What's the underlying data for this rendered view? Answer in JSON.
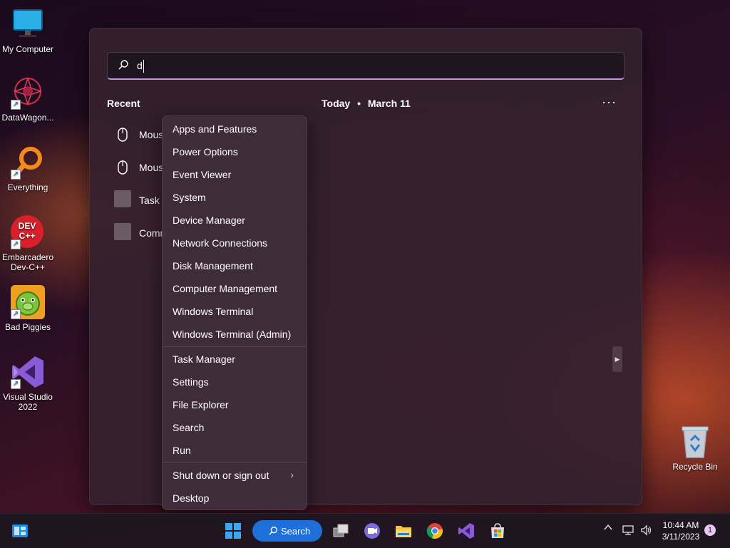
{
  "desktop": {
    "icons": [
      {
        "label": "My Computer"
      },
      {
        "label": "DataWagon..."
      },
      {
        "label": "Everything"
      },
      {
        "label": "Embarcadero Dev-C++",
        "badge_text": "DEV C++"
      },
      {
        "label": "Bad Piggies"
      },
      {
        "label": "Visual Studio 2022"
      },
      {
        "label": "Recycle Bin"
      }
    ]
  },
  "start": {
    "search": {
      "value": "d",
      "icon": "search-icon"
    },
    "recent_title": "Recent",
    "recent_items": [
      {
        "label": "Mous",
        "icon": "mouse-icon"
      },
      {
        "label": "Mous",
        "icon": "mouse-icon"
      },
      {
        "label": "Task I",
        "icon": "app-icon"
      },
      {
        "label": "Comm",
        "icon": "app-icon"
      }
    ],
    "today": "Today",
    "bullet": "•",
    "date": "March 11",
    "more": "···"
  },
  "context_menu": {
    "group1": [
      "Apps and Features",
      "Power Options",
      "Event Viewer",
      "System",
      "Device Manager",
      "Network Connections",
      "Disk Management",
      "Computer Management",
      "Windows Terminal",
      "Windows Terminal (Admin)"
    ],
    "group2": [
      "Task Manager",
      "Settings",
      "File Explorer",
      "Search",
      "Run"
    ],
    "group3": [
      "Shut down or sign out",
      "Desktop"
    ],
    "submenu_chevron": "›"
  },
  "taskbar": {
    "search_label": "Search",
    "clock_time": "10:44 AM",
    "clock_date": "3/11/2023",
    "notification_count": "1",
    "tray_up": "^"
  },
  "colors": {
    "accent": "#1e6fd9",
    "search_underline": "#c09ad8"
  }
}
